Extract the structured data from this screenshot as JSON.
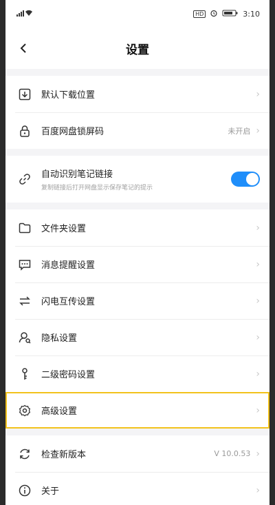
{
  "status_bar": {
    "left": "´ᶜıl ≡",
    "hd_badge": "HD",
    "alarm_icon": "alarm-icon",
    "battery_icon": "battery-icon",
    "time": "3:10"
  },
  "header": {
    "title": "设置"
  },
  "settings": {
    "group1": [
      {
        "label": "默认下载位置",
        "icon": "download-icon"
      },
      {
        "label": "百度网盘锁屏码",
        "icon": "lock-icon",
        "value": "未开启"
      }
    ],
    "group2": [
      {
        "label": "自动识别笔记链接",
        "sublabel": "复制链接后打开网盘显示保存笔记的提示",
        "icon": "link-icon",
        "toggle": true
      }
    ],
    "group3": [
      {
        "label": "文件夹设置",
        "icon": "folder-icon"
      },
      {
        "label": "消息提醒设置",
        "icon": "message-icon"
      },
      {
        "label": "闪电互传设置",
        "icon": "transfer-icon"
      },
      {
        "label": "隐私设置",
        "icon": "privacy-icon"
      },
      {
        "label": "二级密码设置",
        "icon": "key-icon"
      },
      {
        "label": "高级设置",
        "icon": "gear-icon",
        "highlighted": true
      }
    ],
    "group4": [
      {
        "label": "检查新版本",
        "icon": "refresh-icon",
        "value": "V 10.0.53"
      },
      {
        "label": "关于",
        "icon": "info-icon"
      }
    ]
  },
  "colors": {
    "toggle_on": "#1f8efa",
    "highlight": "#f2c21b"
  }
}
